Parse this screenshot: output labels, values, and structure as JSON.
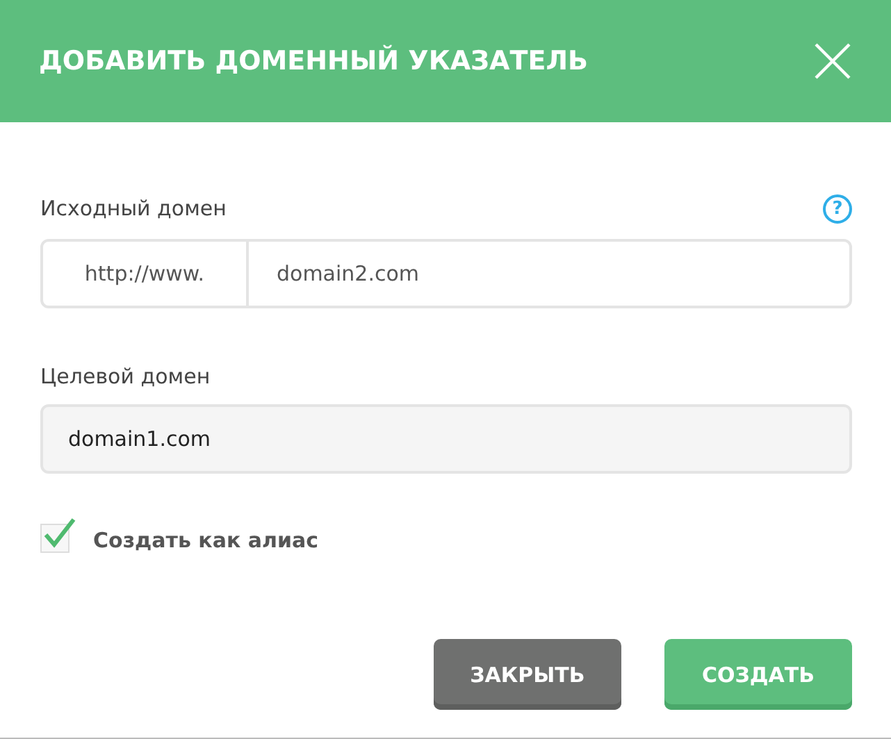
{
  "dialog": {
    "title": "ДОБАВИТЬ ДОМЕННЫЙ УКАЗАТЕЛЬ"
  },
  "source": {
    "label": "Исходный домен",
    "help": "?",
    "prefix": "http://www.",
    "value": "domain2.com"
  },
  "target": {
    "label": "Целевой домен",
    "value": "domain1.com"
  },
  "alias": {
    "label": "Создать как алиас",
    "checked": true
  },
  "buttons": [
    {
      "label": "ЗАКРЫТЬ",
      "kind": "secondary"
    },
    {
      "label": "СОЗДАТЬ",
      "kind": "primary"
    }
  ]
}
